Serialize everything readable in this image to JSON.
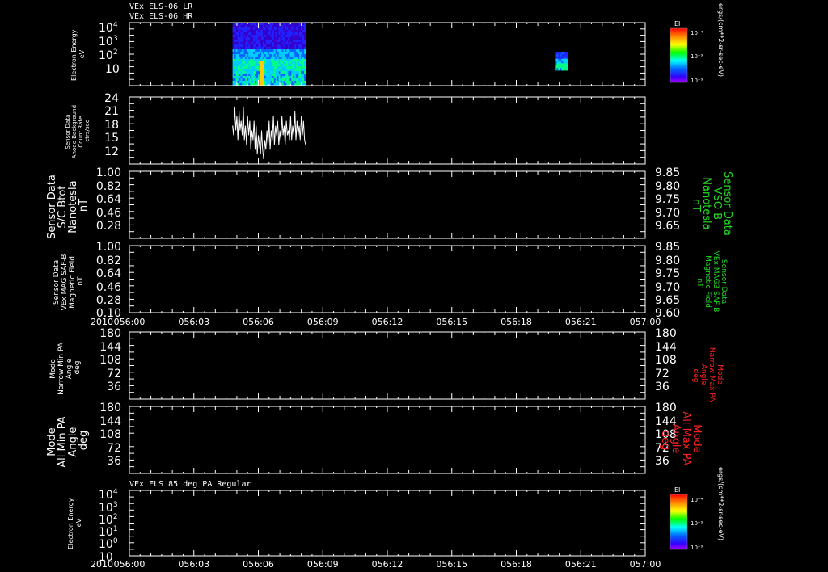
{
  "chart_data": [
    {
      "id": "p1",
      "type": "heatmap",
      "header_lines": [
        "VEx ELS-06 LR",
        "VEx ELS-06 HR"
      ],
      "ylabel_lines": [
        "Electron Energy",
        "eV"
      ],
      "yscale": "log",
      "ylim": [
        1,
        10000
      ],
      "yticks": [
        {
          "exp": "4",
          "v": 10000
        },
        {
          "exp": "3",
          "v": 1000
        },
        {
          "exp": "2",
          "v": 100
        },
        {
          "exp": "",
          "v": 10
        }
      ],
      "colorbar": {
        "title": "EI",
        "ticks": [
          "10⁻⁴",
          "10⁻⁹",
          "10⁻⁹"
        ],
        "units": "ergs/(cm**2-sr-sec-eV)"
      },
      "data_blocks": [
        {
          "t_start": "056:04.8",
          "t_end": "056:08.2",
          "energy_range": [
            1,
            10000
          ],
          "description_level": "low-high mix"
        },
        {
          "t_start": "056:19.8",
          "t_end": "056:20.4",
          "energy_range": [
            2,
            40
          ],
          "description_level": "mid"
        }
      ]
    },
    {
      "id": "p2",
      "type": "line",
      "ylabel_lines": [
        "Sensor Data",
        "Anode Background",
        "Count Rate",
        "ctrs/sec"
      ],
      "ylim": [
        10,
        24
      ],
      "yticks": [
        24,
        21,
        18,
        15,
        12
      ],
      "series": [
        {
          "color": "#ffffff",
          "x_minutes": [
            4.8,
            4.85,
            4.9,
            4.95,
            5.0,
            5.05,
            5.1,
            5.15,
            5.2,
            5.25,
            5.3,
            5.35,
            5.4,
            5.45,
            5.5,
            5.55,
            5.6,
            5.65,
            5.7,
            5.75,
            5.8,
            5.85,
            5.9,
            5.95,
            6.0,
            6.05,
            6.1,
            6.15,
            6.2,
            6.25,
            6.3,
            6.35,
            6.4,
            6.45,
            6.5,
            6.55,
            6.6,
            6.65,
            6.7,
            6.75,
            6.8,
            6.85,
            6.9,
            6.95,
            7.0,
            7.05,
            7.1,
            7.15,
            7.2,
            7.25,
            7.3,
            7.35,
            7.4,
            7.45,
            7.5,
            7.55,
            7.6,
            7.65,
            7.7,
            7.75,
            7.8,
            7.85,
            7.9,
            7.95,
            8.0,
            8.05,
            8.1,
            8.15,
            8.2
          ],
          "values": [
            18,
            16,
            22,
            17,
            20,
            15,
            21,
            17,
            19,
            16,
            22,
            15,
            18,
            14,
            20,
            16,
            19,
            13,
            17,
            15,
            19,
            13,
            18,
            12,
            16,
            14,
            12,
            17,
            13,
            11,
            15,
            13,
            17,
            14,
            19,
            13,
            17,
            15,
            20,
            14,
            18,
            16,
            19,
            14,
            17,
            15,
            20,
            16,
            18,
            14,
            19,
            16,
            17,
            15,
            20,
            15,
            18,
            16,
            21,
            15,
            19,
            16,
            18,
            15,
            20,
            16,
            19,
            15,
            14
          ]
        }
      ]
    },
    {
      "id": "p3",
      "type": "line",
      "ylabel_lines": [
        "Sensor Data",
        "S/C Btot",
        "Nanotesla",
        "nT"
      ],
      "ylim": [
        0.1,
        1.0
      ],
      "yticks": [
        "1.00",
        "0.82",
        "0.64",
        "0.46",
        "0.28"
      ],
      "right_ylim": [
        9.6,
        9.85
      ],
      "right_yticks": [
        "9.85",
        "9.80",
        "9.75",
        "9.70",
        "9.65"
      ],
      "right_label_lines": [
        "Sensor Data",
        "VSO B",
        "Nanotesla",
        "nT"
      ],
      "series": []
    },
    {
      "id": "p4",
      "type": "line",
      "ylabel_lines": [
        "Sensor Data",
        "VEx MAG SAF-B",
        "Magnetic Field",
        "nT"
      ],
      "ylim": [
        0.1,
        1.0
      ],
      "yticks": [
        "1.00",
        "0.82",
        "0.64",
        "0.46",
        "0.28",
        "0.10"
      ],
      "right_ylim": [
        9.6,
        9.85
      ],
      "right_yticks": [
        "9.85",
        "9.80",
        "9.75",
        "9.70",
        "9.65",
        "9.60"
      ],
      "right_label_lines": [
        "Sensor Data",
        "VEx MAG3 SAF-B",
        "Magnetic Field",
        "nT"
      ],
      "xaxis": {
        "year": "2010",
        "ticks": [
          "056:00",
          "056:03",
          "056:06",
          "056:09",
          "056:12",
          "056:15",
          "056:18",
          "056:21",
          "057:00"
        ]
      },
      "series": []
    },
    {
      "id": "p5",
      "type": "line",
      "ylabel_lines": [
        "Mode",
        "Narrow Min PA",
        "Angle",
        "deg"
      ],
      "ylim": [
        0,
        180
      ],
      "yticks": [
        "180",
        "144",
        "108",
        "72",
        "36"
      ],
      "right_ylim": [
        0,
        180
      ],
      "right_yticks": [
        "180",
        "144",
        "108",
        "72",
        "36"
      ],
      "right_label_lines": [
        "Mode",
        "Narrow Max PA",
        "Angle",
        "deg"
      ],
      "series": []
    },
    {
      "id": "p6",
      "type": "line",
      "ylabel_lines": [
        "Mode",
        "All Min PA",
        "Angle",
        "deg"
      ],
      "ylim": [
        0,
        180
      ],
      "yticks": [
        "180",
        "144",
        "108",
        "72",
        "36"
      ],
      "right_ylim": [
        0,
        180
      ],
      "right_yticks": [
        "180",
        "144",
        "108",
        "72",
        "36"
      ],
      "right_label_lines": [
        "Mode",
        "All Max PA",
        "Angle",
        "deg"
      ],
      "series": []
    },
    {
      "id": "p7",
      "type": "heatmap",
      "header_lines": [
        "VEx ELS 85 deg PA Regular"
      ],
      "ylabel_lines": [
        "Electron Energy",
        "eV"
      ],
      "yscale": "log",
      "ylim": [
        10,
        10000
      ],
      "yticks": [
        {
          "exp": "4",
          "v": 10000
        },
        {
          "exp": "3",
          "v": 1000
        },
        {
          "exp": "2",
          "v": 100
        },
        {
          "exp": "1",
          "v": 10
        },
        {
          "exp": "0",
          "v": 1
        },
        {
          "exp": "",
          "v": 0.1
        }
      ],
      "colorbar": {
        "title": "EI",
        "ticks": [
          "10⁻⁴",
          "10⁻⁹",
          "10⁻⁹"
        ],
        "units": "ergs/(cm**2-sr-sec-eV)"
      },
      "xaxis": {
        "year": "2010",
        "ticks": [
          "056:00",
          "056:03",
          "056:06",
          "056:09",
          "056:12",
          "056:15",
          "056:18",
          "056:21",
          "057:00"
        ]
      },
      "data_blocks": []
    }
  ],
  "colors": {
    "background": "#000000",
    "axes": "#ffffff",
    "right_label_green": "#22dd22",
    "right_label_red": "#ff2222"
  }
}
